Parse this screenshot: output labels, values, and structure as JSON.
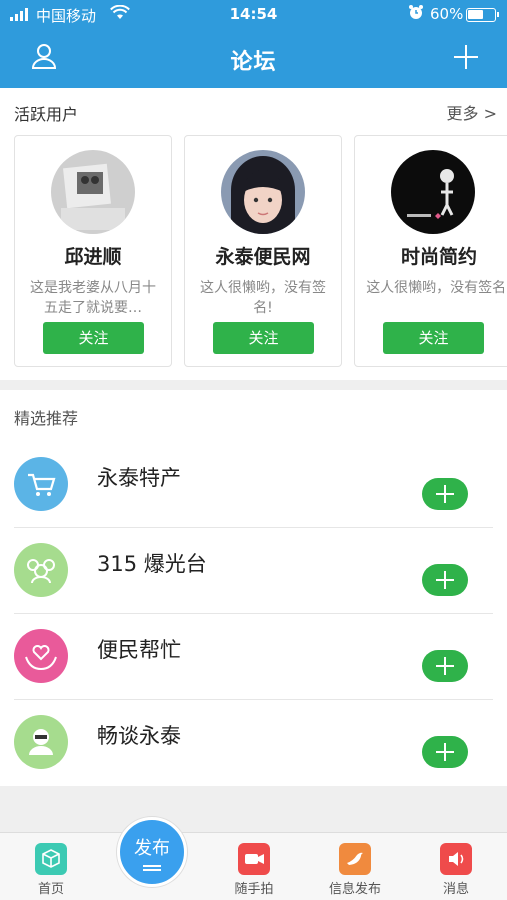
{
  "status_bar": {
    "carrier": "中国移动",
    "time": "14:54",
    "battery": "60%",
    "battery_level": 0.6
  },
  "header": {
    "title": "论坛"
  },
  "active_users": {
    "title": "活跃用户",
    "more": "更多 >",
    "users": [
      {
        "name": "邱进顺",
        "signature": "这是我老婆从八月十五走了就说要…",
        "follow": "关注"
      },
      {
        "name": "永泰便民网",
        "signature": "这人很懒哟，没有签名!",
        "follow": "关注"
      },
      {
        "name": "时尚简约",
        "signature": "这人很懒哟，没有签名!",
        "follow": "关注"
      }
    ]
  },
  "recommend": {
    "title": "精选推荐",
    "items": [
      {
        "name": "永泰特产",
        "icon": "shopping-cart-icon",
        "color": "#5bb4e6"
      },
      {
        "name": "315 爆光台",
        "icon": "people-icon",
        "color": "#a6dc8e"
      },
      {
        "name": "便民帮忙",
        "icon": "heart-hands-icon",
        "color": "#e95a9a"
      },
      {
        "name": "畅谈永泰",
        "icon": "person-icon",
        "color": "#a6dc8e"
      }
    ]
  },
  "tabbar": {
    "items": [
      {
        "label": "首页",
        "icon": "home-cube-icon",
        "color": "#3ccab3"
      },
      {
        "label": "随手拍",
        "icon": "video-camera-icon",
        "color": "#ef4b4b"
      },
      {
        "label": "信息发布",
        "icon": "bird-icon",
        "color": "#f08a3e"
      },
      {
        "label": "消息",
        "icon": "speaker-icon",
        "color": "#ef4b4b"
      }
    ],
    "publish": "发布"
  }
}
